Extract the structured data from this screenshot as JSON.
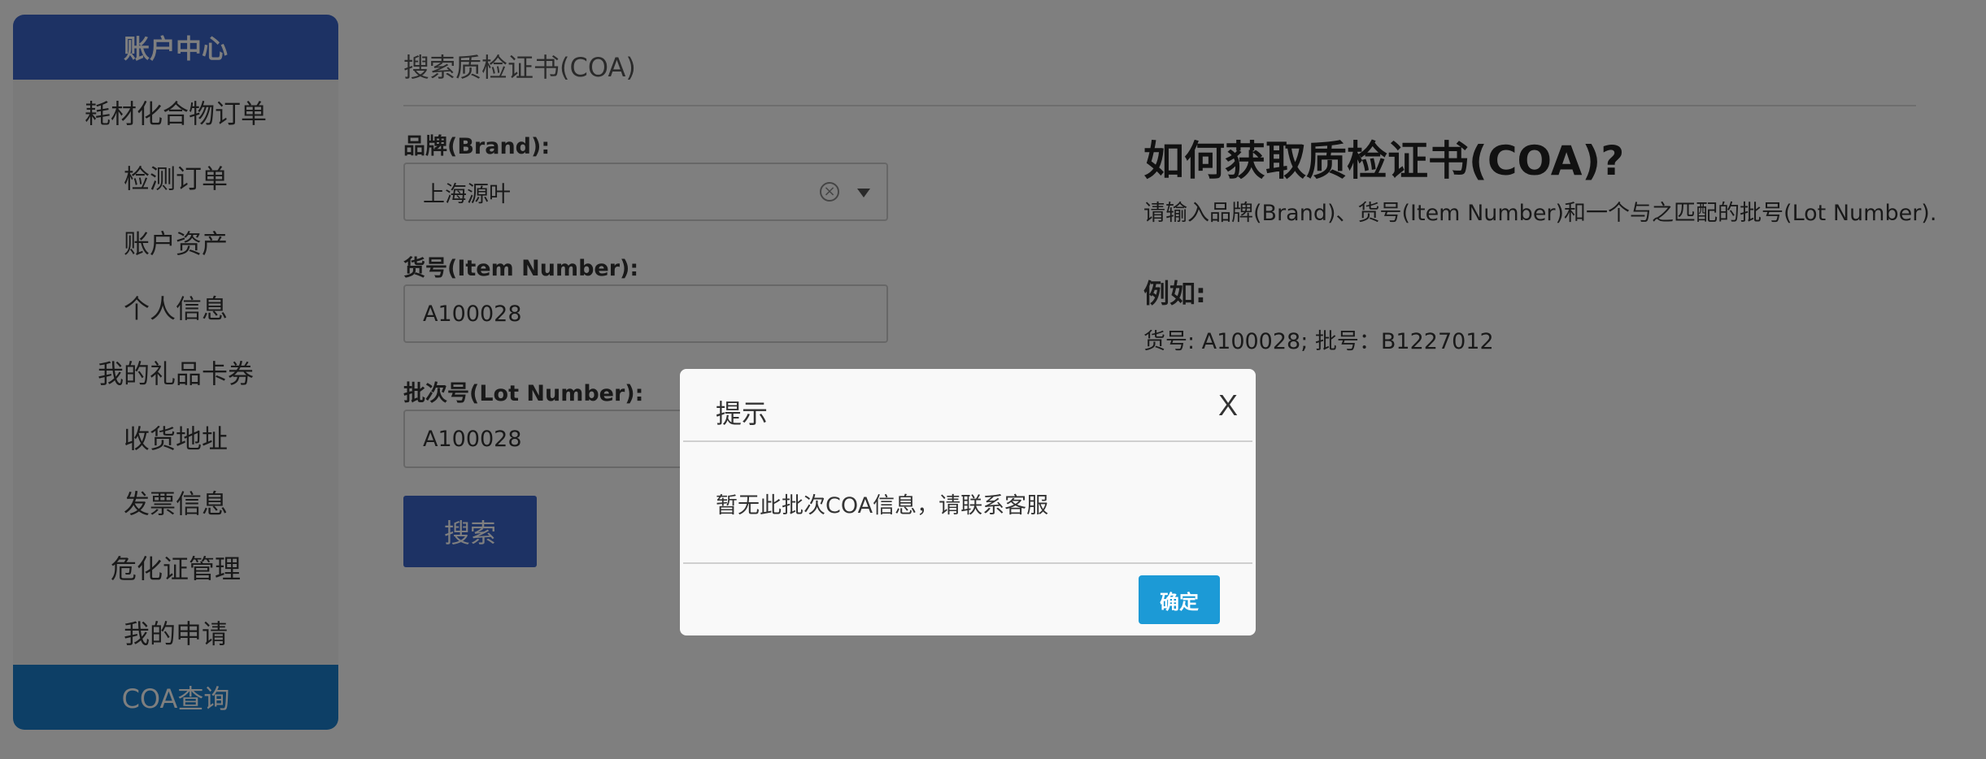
{
  "sidebar": {
    "header": "账户中心",
    "items": [
      {
        "label": "耗材化合物订单"
      },
      {
        "label": "检测订单"
      },
      {
        "label": "账户资产"
      },
      {
        "label": "个人信息"
      },
      {
        "label": "我的礼品卡券"
      },
      {
        "label": "收货地址"
      },
      {
        "label": "发票信息"
      },
      {
        "label": "危化证管理"
      },
      {
        "label": "我的申请"
      },
      {
        "label": "COA查询",
        "active": true
      }
    ]
  },
  "main": {
    "title": "搜索质检证书(COA)",
    "brand": {
      "label": "品牌(Brand):",
      "value": "上海源叶",
      "clear_icon": "clear-circle-icon",
      "dropdown_icon": "chevron-down-icon"
    },
    "item_number": {
      "label": "货号(Item Number):",
      "value": "A100028"
    },
    "lot_number": {
      "label": "批次号(Lot Number):",
      "value": "A100028"
    },
    "search_button": "搜索"
  },
  "help": {
    "title": "如何获取质检证书(COA)?",
    "description": "请输入品牌(Brand)、货号(Item Number)和一个与之匹配的批号(Lot Number).",
    "example_label": "例如:",
    "example_text": "货号: A100028; 批号：B1227012"
  },
  "modal": {
    "title": "提示",
    "close_label": "X",
    "message": "暂无此批次COA信息，请联系客服",
    "confirm_label": "确定"
  },
  "colors": {
    "primary": "#3a64c8",
    "active_item": "#1a7fcc",
    "confirm_button": "#1c9ad6"
  }
}
